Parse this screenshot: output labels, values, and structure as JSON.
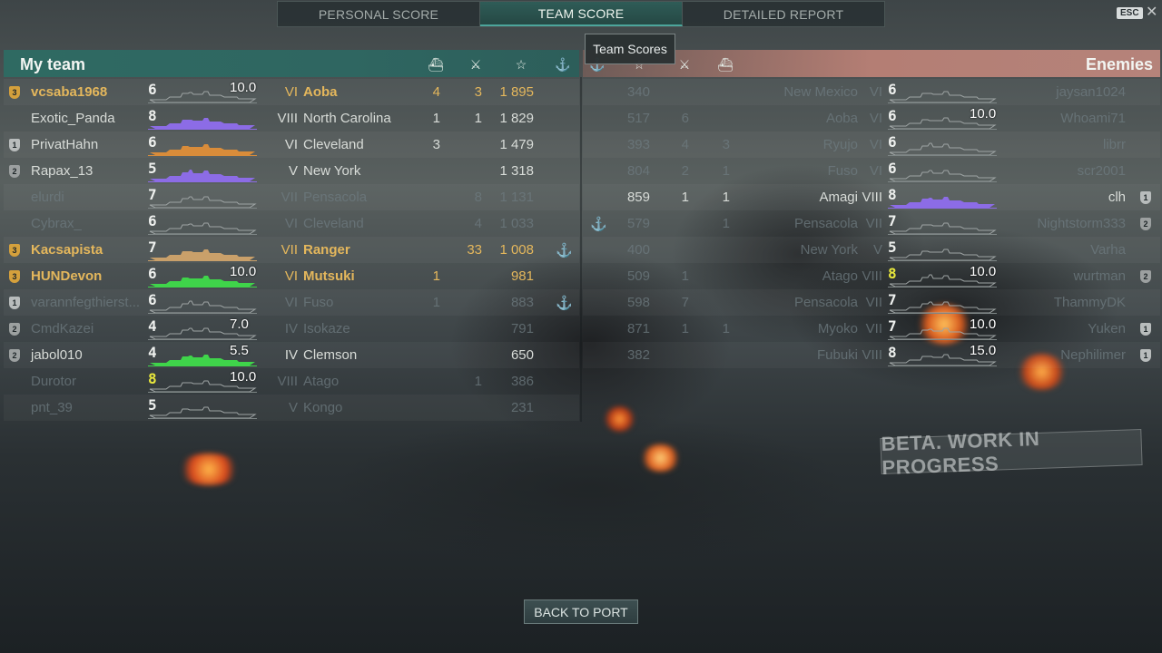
{
  "tabs": [
    {
      "label": "PERSONAL SCORE",
      "active": false
    },
    {
      "label": "TEAM SCORE",
      "active": true
    },
    {
      "label": "DETAILED REPORT",
      "active": false
    }
  ],
  "esc_label": "ESC",
  "close_glyph": "✕",
  "tooltip": "Team Scores",
  "my_team": {
    "title": "My team",
    "header_icons": [
      "plane-kills-icon",
      "ship-kills-icon",
      "score-star-icon",
      "base-capture-anchor-icon"
    ],
    "header_glyphs": [
      "⛴",
      "⚔",
      "☆",
      "⚓"
    ],
    "rows": [
      {
        "rank": "3",
        "player": "vcsaba1968",
        "tier_digit": "6",
        "hp": "10.0",
        "ship_color": "#9ea4a4",
        "tier_roman": "VI",
        "ship": "Aoba",
        "planes": "4",
        "kills": "3",
        "score": "1 895",
        "anchor": "",
        "style": "gold"
      },
      {
        "rank": "",
        "player": "Exotic_Panda",
        "tier_digit": "8",
        "hp": "",
        "ship_color": "#8c6ce6",
        "tier_roman": "VIII",
        "ship": "North Carolina",
        "planes": "1",
        "kills": "1",
        "score": "1 829",
        "anchor": "",
        "style": "normal"
      },
      {
        "rank": "1",
        "player": "PrivatHahn",
        "tier_digit": "6",
        "hp": "",
        "ship_color": "#d98c3a",
        "tier_roman": "VI",
        "ship": "Cleveland",
        "planes": "3",
        "kills": "",
        "score": "1 479",
        "anchor": "",
        "style": "normal"
      },
      {
        "rank": "2",
        "player": "Rapax_13",
        "tier_digit": "5",
        "hp": "",
        "ship_color": "#8c6ce6",
        "tier_roman": "V",
        "ship": "New York",
        "planes": "",
        "kills": "",
        "score": "1 318",
        "anchor": "",
        "style": "normal"
      },
      {
        "rank": "",
        "player": "elurdi",
        "tier_digit": "7",
        "hp": "",
        "ship_color": "#9ea4a4",
        "tier_roman": "VII",
        "ship": "Pensacola",
        "planes": "",
        "kills": "8",
        "score": "1 131",
        "anchor": "",
        "style": "dim"
      },
      {
        "rank": "",
        "player": "Cybrax_",
        "tier_digit": "6",
        "hp": "",
        "ship_color": "#9ea4a4",
        "tier_roman": "VI",
        "ship": "Cleveland",
        "planes": "",
        "kills": "4",
        "score": "1 033",
        "anchor": "",
        "style": "dim"
      },
      {
        "rank": "3",
        "player": "Kacsapista",
        "tier_digit": "7",
        "hp": "",
        "ship_color": "#c9a06a",
        "tier_roman": "VII",
        "ship": "Ranger",
        "planes": "",
        "kills": "33",
        "score": "1 008",
        "anchor": "⚓",
        "style": "gold"
      },
      {
        "rank": "3",
        "player": "HUNDevon",
        "tier_digit": "6",
        "hp": "10.0",
        "ship_color": "#3fd44a",
        "tier_roman": "VI",
        "ship": "Mutsuki",
        "planes": "1",
        "kills": "",
        "score": "981",
        "anchor": "",
        "style": "gold"
      },
      {
        "rank": "1",
        "player": "varannfegthierst...",
        "tier_digit": "6",
        "hp": "",
        "ship_color": "#9ea4a4",
        "tier_roman": "VI",
        "ship": "Fuso",
        "planes": "1",
        "kills": "",
        "score": "883",
        "anchor": "⚓",
        "style": "dim"
      },
      {
        "rank": "2",
        "player": "CmdKazei",
        "tier_digit": "4",
        "hp": "7.0",
        "ship_color": "#9ea4a4",
        "tier_roman": "IV",
        "ship": "Isokaze",
        "planes": "",
        "kills": "",
        "score": "791",
        "anchor": "",
        "style": "dim"
      },
      {
        "rank": "2",
        "player": "jabol010",
        "tier_digit": "4",
        "hp": "5.5",
        "ship_color": "#3fd44a",
        "tier_roman": "IV",
        "ship": "Clemson",
        "planes": "",
        "kills": "",
        "score": "650",
        "anchor": "",
        "style": "normal"
      },
      {
        "rank": "",
        "player": "Durotor",
        "tier_digit": "8",
        "hp": "10.0",
        "ship_color": "#9ea4a4",
        "tier_roman": "VIII",
        "ship": "Atago",
        "planes": "",
        "kills": "1",
        "score": "386",
        "anchor": "",
        "style": "dim",
        "tier_yellow": true
      },
      {
        "rank": "",
        "player": "pnt_39",
        "tier_digit": "5",
        "hp": "",
        "ship_color": "#9ea4a4",
        "tier_roman": "V",
        "ship": "Kongo",
        "planes": "",
        "kills": "",
        "score": "231",
        "anchor": "",
        "style": "dim"
      }
    ]
  },
  "enemies": {
    "title": "Enemies",
    "header_icons": [
      "base-capture-anchor-icon",
      "score-star-icon",
      "ship-kills-icon",
      "plane-kills-icon"
    ],
    "header_glyphs": [
      "⚓",
      "☆",
      "⚔",
      "⛴"
    ],
    "rows": [
      {
        "anchor": "",
        "score": "340",
        "kills": "",
        "planes": "",
        "ship": "New Mexico",
        "tier_roman": "VI",
        "tier_digit": "6",
        "hp": "",
        "ship_color": "#9ea4a4",
        "player": "jaysan1024",
        "rank": "",
        "style": "dim"
      },
      {
        "anchor": "",
        "score": "517",
        "kills": "6",
        "planes": "",
        "ship": "Aoba",
        "tier_roman": "VI",
        "tier_digit": "6",
        "hp": "10.0",
        "ship_color": "#9ea4a4",
        "player": "Whoami71",
        "rank": "",
        "style": "dim"
      },
      {
        "anchor": "",
        "score": "393",
        "kills": "4",
        "planes": "3",
        "ship": "Ryujo",
        "tier_roman": "VI",
        "tier_digit": "6",
        "hp": "",
        "ship_color": "#9ea4a4",
        "player": "librr",
        "rank": "",
        "style": "dim"
      },
      {
        "anchor": "",
        "score": "804",
        "kills": "2",
        "planes": "1",
        "ship": "Fuso",
        "tier_roman": "VI",
        "tier_digit": "6",
        "hp": "",
        "ship_color": "#9ea4a4",
        "player": "scr2001",
        "rank": "",
        "style": "dim"
      },
      {
        "anchor": "",
        "score": "859",
        "kills": "1",
        "planes": "1",
        "ship": "Amagi",
        "tier_roman": "VIII",
        "tier_digit": "8",
        "hp": "",
        "ship_color": "#8c6ce6",
        "player": "clh",
        "rank": "1",
        "style": "normal"
      },
      {
        "anchor": "⚓",
        "score": "579",
        "kills": "",
        "planes": "1",
        "ship": "Pensacola",
        "tier_roman": "VII",
        "tier_digit": "7",
        "hp": "",
        "ship_color": "#9ea4a4",
        "player": "Nightstorm333",
        "rank": "2",
        "style": "dim"
      },
      {
        "anchor": "",
        "score": "400",
        "kills": "",
        "planes": "",
        "ship": "New York",
        "tier_roman": "V",
        "tier_digit": "5",
        "hp": "",
        "ship_color": "#9ea4a4",
        "player": "Varha",
        "rank": "",
        "style": "dim"
      },
      {
        "anchor": "",
        "score": "509",
        "kills": "1",
        "planes": "",
        "ship": "Atago",
        "tier_roman": "VIII",
        "tier_digit": "8",
        "hp": "10.0",
        "ship_color": "#9ea4a4",
        "player": "wurtman",
        "rank": "2",
        "style": "dim",
        "tier_yellow": true
      },
      {
        "anchor": "",
        "score": "598",
        "kills": "7",
        "planes": "",
        "ship": "Pensacola",
        "tier_roman": "VII",
        "tier_digit": "7",
        "hp": "",
        "ship_color": "#9ea4a4",
        "player": "ThammyDK",
        "rank": "",
        "style": "dim"
      },
      {
        "anchor": "",
        "score": "871",
        "kills": "1",
        "planes": "1",
        "ship": "Myoko",
        "tier_roman": "VII",
        "tier_digit": "7",
        "hp": "10.0",
        "ship_color": "#9ea4a4",
        "player": "Yuken",
        "rank": "1",
        "style": "dim"
      },
      {
        "anchor": "",
        "score": "382",
        "kills": "",
        "planes": "",
        "ship": "Fubuki",
        "tier_roman": "VIII",
        "tier_digit": "8",
        "hp": "15.0",
        "ship_color": "#9ea4a4",
        "player": "Nephilimer",
        "rank": "1",
        "style": "dim"
      }
    ]
  },
  "beta_watermark": "BETA. WORK IN PROGRESS",
  "back_button": "BACK TO PORT"
}
